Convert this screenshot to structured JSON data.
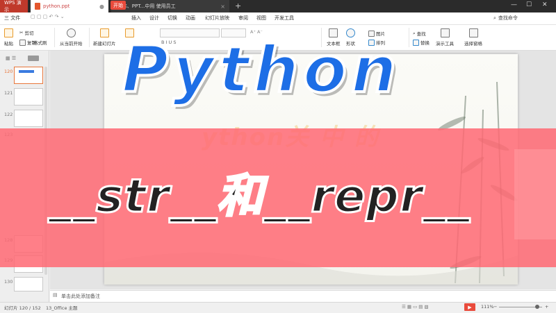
{
  "titlebar": {
    "app_tab": "WPS 演示",
    "file_tab1": "python.ppt",
    "file_tab2": "X、PPT...中用 使用员工",
    "new_tab": "+"
  },
  "menubar": {
    "file": "三 文件",
    "items": [
      "开始",
      "插入",
      "设计",
      "切换",
      "动画",
      "幻灯片放映",
      "审阅",
      "视图",
      "开发工具"
    ],
    "search": "查找命令"
  },
  "ribbon": {
    "paste": "粘贴",
    "cut": "剪切",
    "copy": "复制",
    "format_painter": "格式刷",
    "from_current": "从当前开始",
    "new_slide": "新建幻灯片",
    "textbox": "文本框",
    "shape": "形状",
    "picture": "图片",
    "arrange": "排列",
    "find": "查找",
    "replace": "替换",
    "presenter": "演示工具",
    "select_pane": "选择窗格"
  },
  "left_panel": {
    "badge": "",
    "slide_numbers": [
      "120",
      "121",
      "122",
      "123",
      "128",
      "129",
      "130"
    ]
  },
  "slide": {
    "subtitle_faded": "ython关 中 的"
  },
  "overlay": {
    "title": "Python",
    "subtitle": "__str__和__repr__"
  },
  "notes": {
    "placeholder": "单击此处添加备注"
  },
  "status": {
    "slide_position": "幻灯片 120 / 152",
    "theme": "13_Office 主题",
    "zoom": "111%"
  }
}
